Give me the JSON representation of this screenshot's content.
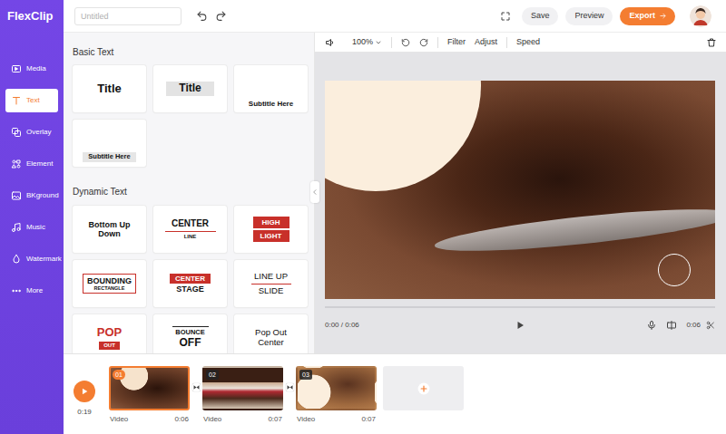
{
  "app": {
    "logo": "FlexClip"
  },
  "project": {
    "title_placeholder": "Untitled"
  },
  "topbar": {
    "save": "Save",
    "preview": "Preview",
    "export": "Export"
  },
  "sidebar": {
    "items": [
      {
        "label": "Media",
        "selected": false
      },
      {
        "label": "Text",
        "selected": true
      },
      {
        "label": "Overlay",
        "selected": false
      },
      {
        "label": "Element",
        "selected": false
      },
      {
        "label": "BKground",
        "selected": false
      },
      {
        "label": "Music",
        "selected": false
      },
      {
        "label": "Watermark",
        "selected": false
      },
      {
        "label": "More",
        "selected": false
      }
    ]
  },
  "panel": {
    "sections": [
      {
        "title": "Basic Text",
        "items": [
          {
            "kind": "title",
            "lines": [
              "Title"
            ]
          },
          {
            "kind": "title-box",
            "lines": [
              "Title"
            ]
          },
          {
            "kind": "subtitle",
            "lines": [
              "Subtitle Here"
            ]
          },
          {
            "kind": "subtitle-box",
            "lines": [
              "Subtitle Here"
            ]
          }
        ]
      },
      {
        "title": "Dynamic Text",
        "items": [
          {
            "kind": "stack",
            "lines": [
              "Bottom Up",
              "Down"
            ]
          },
          {
            "kind": "center-line",
            "lines": [
              "CENTER",
              "LINE"
            ]
          },
          {
            "kind": "highlight",
            "lines": [
              "HIGH",
              "LIGHT"
            ]
          },
          {
            "kind": "bounding",
            "lines": [
              "BOUNDING",
              "RECTANGLE"
            ]
          },
          {
            "kind": "center-stage",
            "lines": [
              "CENTER",
              "STAGE"
            ]
          },
          {
            "kind": "line-up",
            "lines": [
              "LINE UP",
              "SLIDE"
            ]
          },
          {
            "kind": "pop",
            "lines": [
              "POP",
              "OUT"
            ]
          },
          {
            "kind": "bounce",
            "lines": [
              "BOUNCE",
              "OFF"
            ]
          },
          {
            "kind": "plain-stack",
            "lines": [
              "Pop Out",
              "Center"
            ]
          }
        ]
      }
    ]
  },
  "toolbar": {
    "zoom": "100%",
    "items": [
      "Filter",
      "Adjust",
      "Speed"
    ]
  },
  "player": {
    "position": "0:00 / 0:06",
    "duration": "0:06"
  },
  "timeline": {
    "total": "0:19",
    "clips": [
      {
        "badge": "01",
        "type": "Video",
        "duration": "0:06",
        "selected": true
      },
      {
        "badge": "02",
        "type": "Video",
        "duration": "0:07",
        "selected": false
      },
      {
        "badge": "03",
        "type": "Video",
        "duration": "0:07",
        "selected": false
      }
    ]
  }
}
